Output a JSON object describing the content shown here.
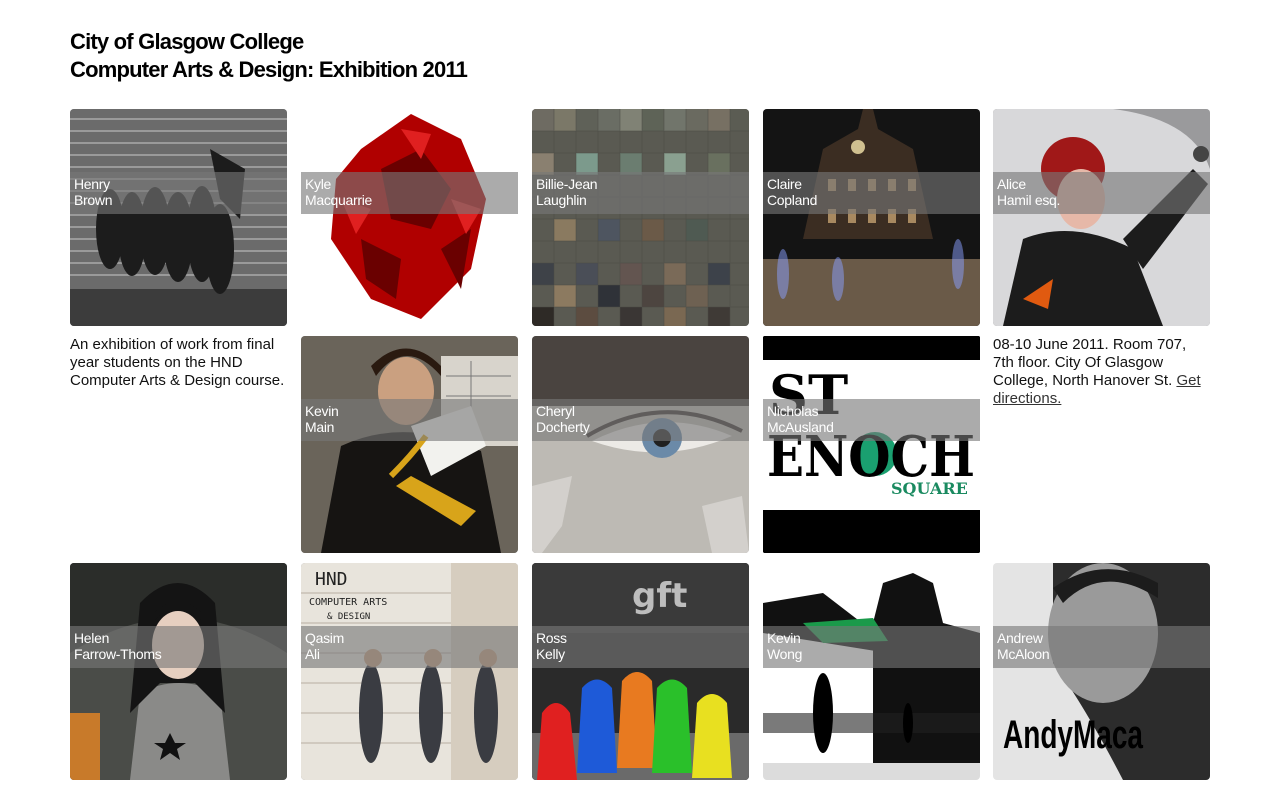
{
  "header": {
    "title_line1": "City of Glasgow College",
    "title_line2": "Computer Arts & Design: Exhibition 2011"
  },
  "students": [
    {
      "first": "Henry",
      "last": "Brown"
    },
    {
      "first": "Kyle",
      "last": "Macquarrie"
    },
    {
      "first": "Billie-Jean",
      "last": "Laughlin"
    },
    {
      "first": "Claire",
      "last": "Copland"
    },
    {
      "first": "Alice",
      "last": "Hamil esq."
    },
    {
      "first": "Kevin",
      "last": "Main"
    },
    {
      "first": "Cheryl",
      "last": "Docherty"
    },
    {
      "first": "Nicholas",
      "last": "McAusland"
    },
    {
      "first": "Helen",
      "last": "Farrow-Thoms"
    },
    {
      "first": "Qasim",
      "last": "Ali"
    },
    {
      "first": "Ross",
      "last": "Kelly"
    },
    {
      "first": "Kevin",
      "last": "Wong"
    },
    {
      "first": "Andrew",
      "last": "McAloon"
    }
  ],
  "intro": {
    "text": "An exhibition of work from final year students on the HND Computer Arts & Design course."
  },
  "info": {
    "text": "08-10 June 2011. Room 707, 7th floor. City Of Glasgow College, North Hanover St.",
    "link": "Get directions."
  },
  "art_text": {
    "st_enoch_line1": "ST",
    "st_enoch_line2": "ENOCH",
    "st_enoch_line3": "SQUARE",
    "gft": "gft",
    "hnd_line1": "HND",
    "hnd_line2": "COMPUTER ARTS",
    "hnd_line3": "& DESIGN",
    "andymaca": "AndyMaca"
  }
}
